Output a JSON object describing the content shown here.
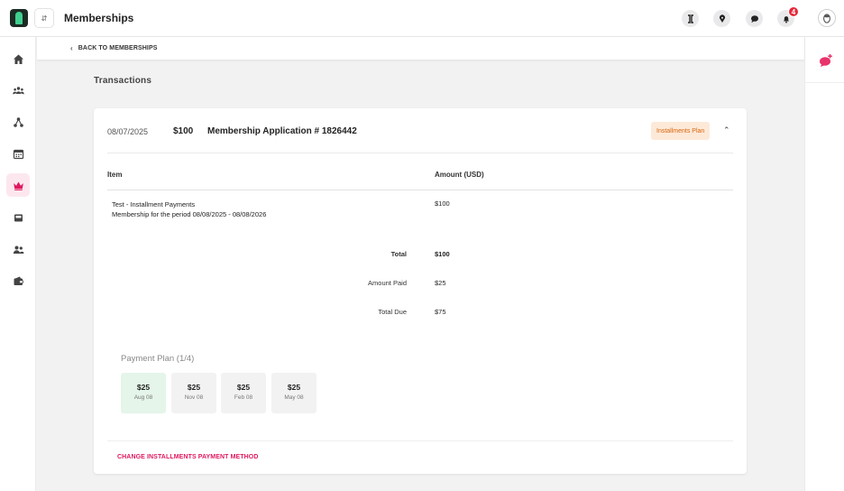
{
  "app": {
    "page_title": "Memberships"
  },
  "topbar": {
    "notification_count": "4"
  },
  "breadcrumb": {
    "label": "BACK TO MEMBERSHIPS"
  },
  "section": {
    "title": "Transactions"
  },
  "transaction": {
    "date": "08/07/2025",
    "amount": "$100",
    "title": "Membership Application # 1826442",
    "badge": "Installments Plan",
    "columns": {
      "item": "Item",
      "amount": "Amount (USD)"
    },
    "line_items": [
      {
        "name": "Test - Installment Payments",
        "description": "Membership for the period 08/08/2025 - 08/08/2026",
        "amount": "$100"
      }
    ],
    "summary": {
      "total_label": "Total",
      "total_value": "$100",
      "paid_label": "Amount Paid",
      "paid_value": "$25",
      "due_label": "Total Due",
      "due_value": "$75"
    },
    "payment_plan": {
      "title": "Payment Plan (1/4)",
      "installments": [
        {
          "amount": "$25",
          "date": "Aug 08",
          "paid": true
        },
        {
          "amount": "$25",
          "date": "Nov 08",
          "paid": false
        },
        {
          "amount": "$25",
          "date": "Feb 08",
          "paid": false
        },
        {
          "amount": "$25",
          "date": "May 08",
          "paid": false
        }
      ]
    },
    "change_method_label": "CHANGE INSTALLMENTS PAYMENT METHOD"
  },
  "colors": {
    "accent": "#e0185f",
    "badge_bg": "#fde9d8",
    "badge_text": "#d9650d",
    "paid_bg": "#e5f5ea"
  }
}
